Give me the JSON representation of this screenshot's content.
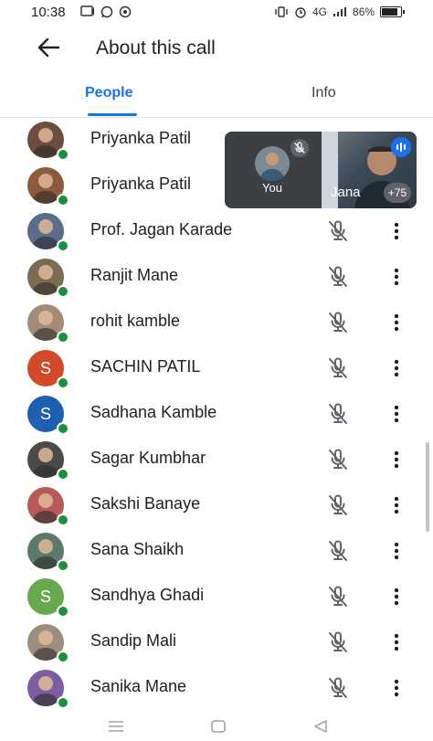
{
  "status_bar": {
    "time": "10:38",
    "battery_text": "86%",
    "network_text": "4G"
  },
  "app_bar": {
    "title": "About this call"
  },
  "tabs": [
    {
      "label": "People",
      "active": true
    },
    {
      "label": "Info",
      "active": false
    }
  ],
  "pip": {
    "self_label": "You",
    "remote_label": "Jana",
    "more_count": "+75"
  },
  "participants": [
    {
      "name": "Priyanka Patil",
      "avatar_color": "#6d4c41",
      "avatar_letter": ""
    },
    {
      "name": "Priyanka Patil",
      "avatar_color": "#8d5a3b",
      "avatar_letter": ""
    },
    {
      "name": "Prof. Jagan Karade",
      "avatar_color": "#5b6d8a",
      "avatar_letter": ""
    },
    {
      "name": "Ranjit Mane",
      "avatar_color": "#7b6b52",
      "avatar_letter": ""
    },
    {
      "name": "rohit kamble",
      "avatar_color": "#a38b7a",
      "avatar_letter": ""
    },
    {
      "name": "SACHIN PATIL",
      "avatar_color": "#d14b2a",
      "avatar_letter": "S"
    },
    {
      "name": "Sadhana Kamble",
      "avatar_color": "#1e5fb0",
      "avatar_letter": "S"
    },
    {
      "name": "Sagar Kumbhar",
      "avatar_color": "#4a4a4a",
      "avatar_letter": ""
    },
    {
      "name": "Sakshi Banaye",
      "avatar_color": "#b85a5a",
      "avatar_letter": ""
    },
    {
      "name": "Sana Shaikh",
      "avatar_color": "#5b7a6a",
      "avatar_letter": ""
    },
    {
      "name": "Sandhya Ghadi",
      "avatar_color": "#6aa84f",
      "avatar_letter": "S"
    },
    {
      "name": "Sandip Mali",
      "avatar_color": "#9c8e7e",
      "avatar_letter": ""
    },
    {
      "name": "Sanika Mane",
      "avatar_color": "#7a5ea0",
      "avatar_letter": ""
    }
  ],
  "colors": {
    "accent": "#1a73e8",
    "online": "#1e8e3e"
  }
}
